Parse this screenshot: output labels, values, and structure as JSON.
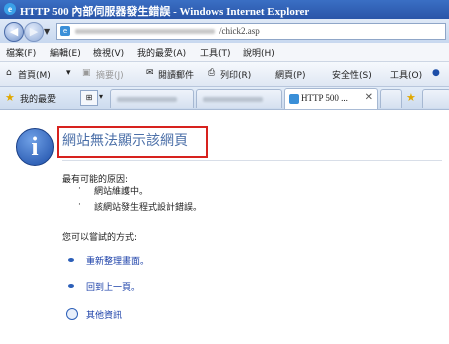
{
  "window": {
    "title": "HTTP 500 內部伺服器發生錯誤 - Windows Internet Explorer"
  },
  "address": {
    "url_suffix": "/chick2.asp"
  },
  "menu": {
    "items": [
      "檔案(F)",
      "編輯(E)",
      "檢視(V)",
      "我的最愛(A)",
      "工具(T)",
      "說明(H)"
    ]
  },
  "command_bar": {
    "home": "首頁(M)",
    "feeds": "摘要(J)",
    "mail": "閱讀郵件",
    "print": "列印(R)",
    "page": "網頁(P)",
    "safety": "安全性(S)",
    "tools": "工具(O)"
  },
  "tabs": {
    "favorites_label": "我的最愛",
    "active_tab_label": "HTTP 500 ..."
  },
  "error_page": {
    "heading": "網站無法顯示該網頁",
    "causes_title": "最有可能的原因:",
    "causes": [
      "網站維護中。",
      "該網站發生程式設計錯誤。"
    ],
    "try_title": "您可以嘗試的方式:",
    "actions": [
      "重新整理畫面。",
      "回到上一頁。"
    ],
    "more_info": "其他資訊"
  },
  "colors": {
    "heading": "#4b6fa8",
    "link": "#1a3fa8",
    "highlight_box": "#d7221e",
    "titlebar": "#2a55a8"
  }
}
